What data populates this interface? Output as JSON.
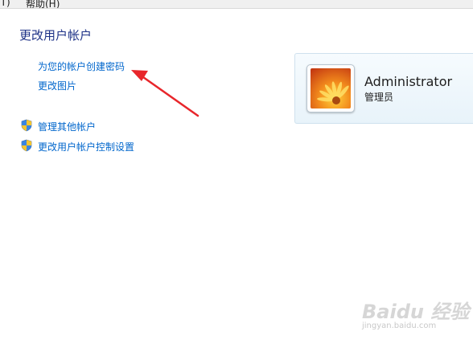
{
  "menu": {
    "items": [
      {
        "label": "(T)"
      },
      {
        "label": "帮助(H)"
      }
    ]
  },
  "page_title": "更改用户帐户",
  "tasks": [
    {
      "label": "为您的帐户创建密码"
    },
    {
      "label": "更改图片"
    }
  ],
  "admin_tasks": [
    {
      "label": "管理其他帐户",
      "icon": "uac-shield-icon"
    },
    {
      "label": "更改用户帐户控制设置",
      "icon": "uac-shield-icon"
    }
  ],
  "account": {
    "name": "Administrator",
    "role": "管理员",
    "avatar": "orange-flower"
  },
  "annotation": {
    "arrow_color": "#e8262b"
  },
  "watermark": {
    "brand": "Baidu 经验",
    "site": "jingyan.baidu.com"
  },
  "colors": {
    "link": "#0066cc",
    "title": "#1e3287"
  }
}
